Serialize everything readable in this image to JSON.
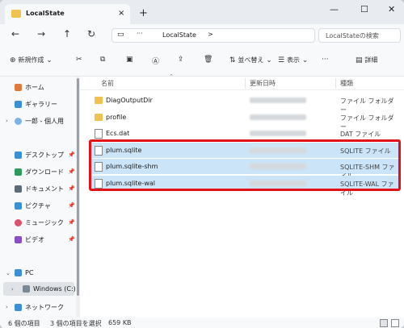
{
  "tab": {
    "title": "LocalState",
    "close": "×",
    "new_tab": "+"
  },
  "window_controls": {
    "minimize": "—",
    "maximize": "☐",
    "close": "✕"
  },
  "nav": {
    "back": "←",
    "forward": "→",
    "up": "↑",
    "refresh": "↻"
  },
  "address": {
    "more": "···",
    "crumb": "LocalState",
    "chevron": ">"
  },
  "search": {
    "placeholder": "LocalStateの検索"
  },
  "toolbar": {
    "new_label": "新規作成",
    "sort_label": "並べ替え",
    "view_label": "表示",
    "more": "···",
    "details_label": "詳細"
  },
  "sidebar": {
    "home": "ホーム",
    "gallery": "ギャラリー",
    "user": "一郎 - 個人用",
    "desktop": "デスクトップ",
    "downloads": "ダウンロード",
    "documents": "ドキュメント",
    "pictures": "ピクチャ",
    "music": "ミュージック",
    "videos": "ビデオ",
    "pc": "PC",
    "drive": "Windows (C:)",
    "network": "ネットワーク"
  },
  "columns": {
    "name": "名前",
    "date": "更新日時",
    "type": "種類"
  },
  "files": [
    {
      "name": "DiagOutputDir",
      "type": "ファイル フォルダー",
      "kind": "folder",
      "selected": false
    },
    {
      "name": "profile",
      "type": "ファイル フォルダー",
      "kind": "folder",
      "selected": false
    },
    {
      "name": "Ecs.dat",
      "type": "DAT ファイル",
      "kind": "doc",
      "selected": false
    },
    {
      "name": "plum.sqlite",
      "type": "SQLITE ファイル",
      "kind": "doc",
      "selected": true
    },
    {
      "name": "plum.sqlite-shm",
      "type": "SQLITE-SHM ファイル",
      "kind": "doc",
      "selected": true
    },
    {
      "name": "plum.sqlite-wal",
      "type": "SQLITE-WAL ファイル",
      "kind": "doc",
      "selected": true
    }
  ],
  "status": {
    "count": "6 個の項目",
    "selection": "3 個の項目を選択",
    "size": "659 KB"
  },
  "colors": {
    "accent": "#e3121a",
    "selection": "#cce4f7",
    "folder": "#f0c24f"
  }
}
